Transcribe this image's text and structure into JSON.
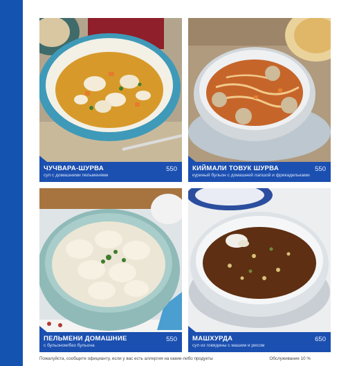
{
  "menu_items": [
    {
      "name": "ЧУЧВАРА-ШУРВА",
      "description": "суп с домашними пельменями",
      "price": "550"
    },
    {
      "name": "КИЙМАЛИ ТОВУК ШУРВА",
      "description": "куриный бульон с домашней лапшой и фрикадельками",
      "price": "550"
    },
    {
      "name": "ПЕЛЬМЕНИ ДОМАШНИЕ",
      "description": "с бульоном/без бульона",
      "price": "550"
    },
    {
      "name": "МАШХУРДА",
      "description": "суп из говядины с машем и рисом",
      "price": "650"
    }
  ],
  "footer": {
    "note": "Пожалуйста, сообщите официанту, если у вас есть аллергия на какие-либо продукты",
    "service": "Обслуживание 10 %"
  },
  "colors": {
    "accent_blue": "#1b4fb0",
    "side_bar": "#1553b0"
  }
}
